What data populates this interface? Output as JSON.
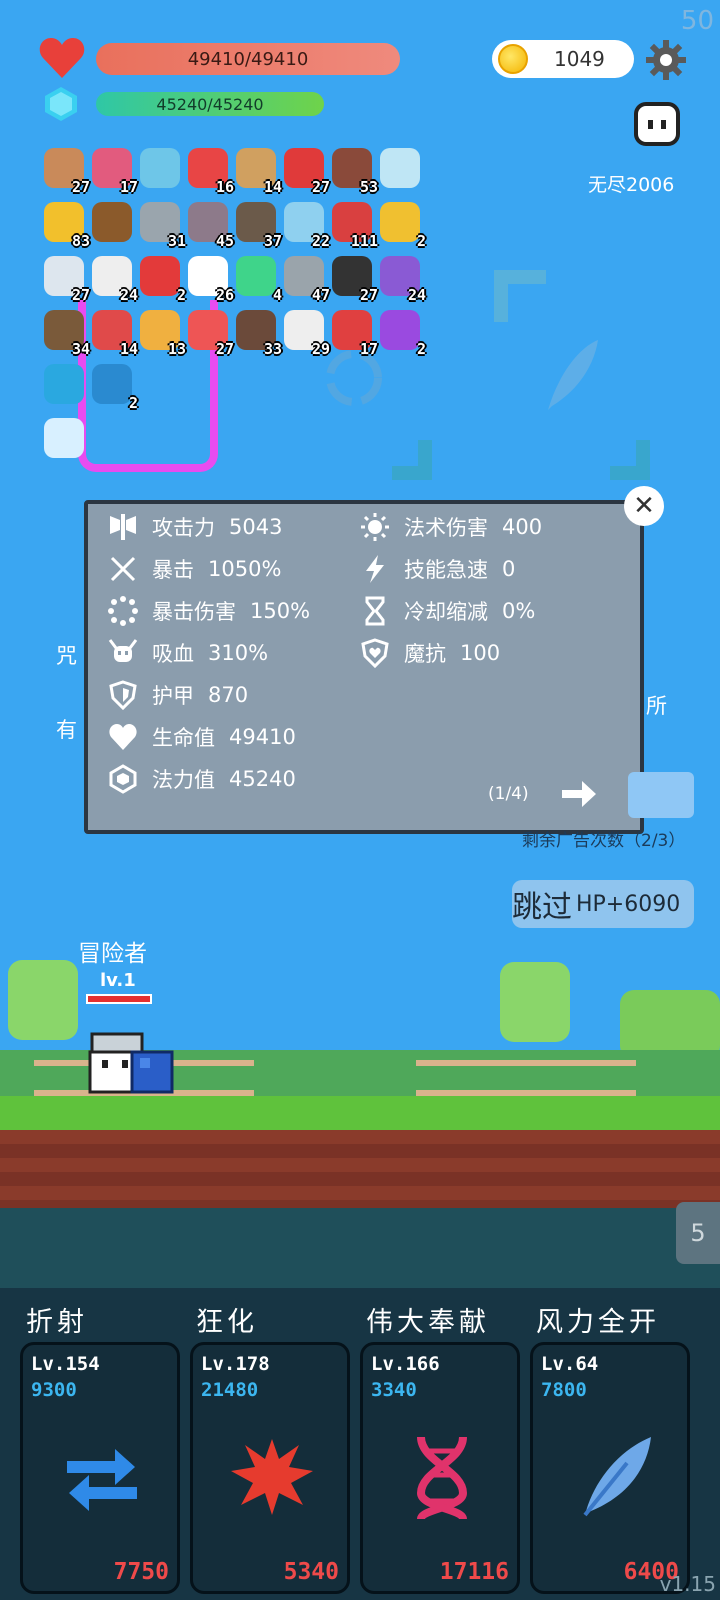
{
  "corner_number": "50",
  "hp": {
    "text": "49410/49410"
  },
  "mp": {
    "text": "45240/45240"
  },
  "coins": "1049",
  "mode_text": "无尽2006",
  "items": [
    {
      "icon": "shield-icon",
      "count": "27",
      "color": "#c98a5a"
    },
    {
      "icon": "potion-icon",
      "count": "17",
      "color": "#e25b7e"
    },
    {
      "icon": "magnifier-icon",
      "count": "",
      "color": "#6ec6e8"
    },
    {
      "icon": "watermelon-icon",
      "count": "16",
      "color": "#e84545"
    },
    {
      "icon": "sword-icon",
      "count": "14",
      "color": "#d0a060"
    },
    {
      "icon": "strawberry-icon",
      "count": "27",
      "color": "#e03a3a"
    },
    {
      "icon": "cake-icon",
      "count": "53",
      "color": "#8a4a3a"
    },
    {
      "icon": "bone-icon",
      "count": "",
      "color": "#bfe6f5"
    },
    {
      "icon": "sunflower-icon",
      "count": "83",
      "color": "#f2c02c"
    },
    {
      "icon": "chest-icon",
      "count": "",
      "color": "#8b5a2b"
    },
    {
      "icon": "mace-icon",
      "count": "31",
      "color": "#9aa5ad"
    },
    {
      "icon": "gate-icon",
      "count": "45",
      "color": "#8d7a8a"
    },
    {
      "icon": "arrows-icon",
      "count": "37",
      "color": "#6b5a4a"
    },
    {
      "icon": "shell-icon",
      "count": "22",
      "color": "#8fd0ef"
    },
    {
      "icon": "card-icon",
      "count": "111",
      "color": "#d94040"
    },
    {
      "icon": "ring-icon",
      "count": "2",
      "color": "#f0c030"
    },
    {
      "icon": "light-icon",
      "count": "27",
      "color": "#dde6ee"
    },
    {
      "icon": "dice-icon",
      "count": "24",
      "color": "#eeeeee"
    },
    {
      "icon": "hearts-icon",
      "count": "2",
      "color": "#e33a3a"
    },
    {
      "icon": "ghost-icon",
      "count": "26",
      "color": "#ffffff"
    },
    {
      "icon": "slime-icon",
      "count": "4",
      "color": "#3fd48a"
    },
    {
      "icon": "axe-icon",
      "count": "47",
      "color": "#9aa4ab"
    },
    {
      "icon": "bomb-icon",
      "count": "27",
      "color": "#333333"
    },
    {
      "icon": "box-icon",
      "count": "24",
      "color": "#8a5ad4"
    },
    {
      "icon": "bow-icon",
      "count": "34",
      "color": "#7a5a3a"
    },
    {
      "icon": "ball-icon",
      "count": "14",
      "color": "#e04a4a"
    },
    {
      "icon": "book-icon",
      "count": "13",
      "color": "#f0b040"
    },
    {
      "icon": "pill-icon",
      "count": "27",
      "color": "#ee5555"
    },
    {
      "icon": "coconut-icon",
      "count": "33",
      "color": "#6b4a3a"
    },
    {
      "icon": "letter-icon",
      "count": "29",
      "color": "#eeeeee"
    },
    {
      "icon": "flask-icon",
      "count": "17",
      "color": "#e04040"
    },
    {
      "icon": "orb-icon",
      "count": "2",
      "color": "#9a4ae0"
    },
    {
      "icon": "hexgem-icon",
      "count": "",
      "color": "#2aa8e0"
    },
    {
      "icon": "bubbles-icon",
      "count": "2",
      "color": "#2a8ad0"
    },
    {
      "icon": "lightbulb-icon",
      "count": "",
      "color": "#d8f0ff"
    }
  ],
  "stats": {
    "left": [
      {
        "icon": "axe-icon",
        "label": "攻击力",
        "value": "5043"
      },
      {
        "icon": "crit-icon",
        "label": "暴击",
        "value": "1050%"
      },
      {
        "icon": "crit-dmg-icon",
        "label": "暴击伤害",
        "value": "150%"
      },
      {
        "icon": "skull-icon",
        "label": "吸血",
        "value": "310%"
      },
      {
        "icon": "armor-icon",
        "label": "护甲",
        "value": "870"
      },
      {
        "icon": "heart-icon",
        "label": "生命值",
        "value": "49410"
      },
      {
        "icon": "mana-icon",
        "label": "法力值",
        "value": "45240"
      }
    ],
    "right": [
      {
        "icon": "sun-icon",
        "label": "法术伤害",
        "value": "400"
      },
      {
        "icon": "lightning-icon",
        "label": "技能急速",
        "value": "0"
      },
      {
        "icon": "hourglass-icon",
        "label": "冷却缩减",
        "value": "0%"
      },
      {
        "icon": "magic-shield-icon",
        "label": "魔抗",
        "value": "100"
      }
    ],
    "page": "(1/4)"
  },
  "behind": {
    "left1": "咒",
    "left2": "有",
    "right1": "所",
    "remaining": "剩余广告次数（2/3）"
  },
  "skip": {
    "label": "跳过",
    "hp": "HP+6090"
  },
  "hero": {
    "name": "冒险者",
    "level": "lv.1"
  },
  "wave": "5",
  "skills": [
    {
      "name": "折射",
      "level": "Lv.154",
      "cost": "9300",
      "price": "7750",
      "icon": "swap-arrows-icon"
    },
    {
      "name": "狂化",
      "level": "Lv.178",
      "cost": "21480",
      "price": "5340",
      "icon": "splat-icon"
    },
    {
      "name": "伟大奉献",
      "level": "Lv.166",
      "cost": "3340",
      "price": "17116",
      "icon": "dna-icon"
    },
    {
      "name": "风力全开",
      "level": "Lv.64",
      "cost": "7800",
      "price": "6400",
      "icon": "feather-icon"
    }
  ],
  "version": "v1.15"
}
